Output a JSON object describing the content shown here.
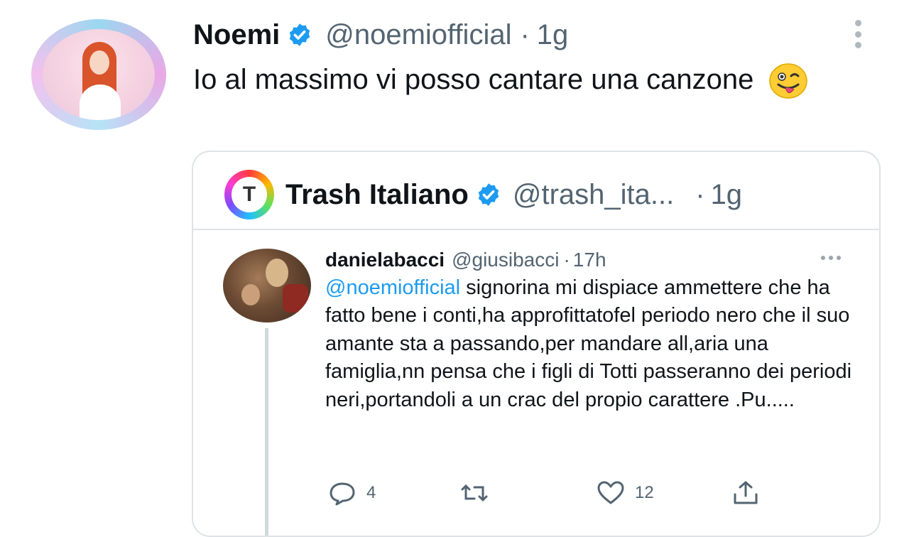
{
  "tweet": {
    "author_name": "Noemi",
    "author_handle": "@noemiofficial",
    "separator": "·",
    "time": "1g",
    "text": "Io al massimo vi posso cantare una canzone",
    "icons": {
      "verified": "verified-badge-icon",
      "more": "more-vertical-icon",
      "emoji": "winking-tongue-emoji-icon"
    }
  },
  "quote": {
    "author_name": "Trash Italiano",
    "author_handle": "@trash_ita...",
    "separator": "·",
    "time": "1g",
    "avatar_letter": "T",
    "reply": {
      "author_name": "danielabacci",
      "author_handle": "@giusibacci",
      "separator": "·",
      "time": "17h",
      "mention": "@noemiofficial",
      "text": "signorina mi dispiace ammettere che ha fatto bene i conti,ha approfittatofel periodo nero che il suo amante sta a passando,per mandare all,aria una famiglia,nn pensa che i figli di Totti passeranno dei periodi neri,portandoli a un crac del propio carattere .Pu.....",
      "actions": {
        "reply_count": "4",
        "retweet_count": "",
        "like_count": "12"
      }
    }
  },
  "colors": {
    "verified": "#1d9bf0",
    "link": "#1d9bf0",
    "muted": "#536471",
    "border": "#dfe3e6"
  }
}
